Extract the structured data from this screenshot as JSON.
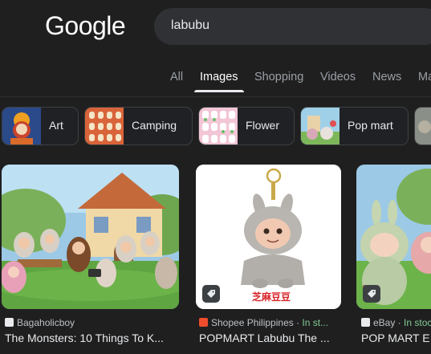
{
  "logo": "Google",
  "search": {
    "value": "labubu"
  },
  "tabs": [
    {
      "label": "All"
    },
    {
      "label": "Images"
    },
    {
      "label": "Shopping"
    },
    {
      "label": "Videos"
    },
    {
      "label": "News"
    },
    {
      "label": "Ma"
    }
  ],
  "chips": [
    {
      "label": "Art"
    },
    {
      "label": "Camping"
    },
    {
      "label": "Flower"
    },
    {
      "label": "Pop mart"
    }
  ],
  "results": [
    {
      "source": "Bagaholicboy",
      "stock": "",
      "title": "The Monsters: 10 Things To K..."
    },
    {
      "source": "Shopee Philippines · ",
      "stock": "In st...",
      "title": "POPMART Labubu The ..."
    },
    {
      "source": "eBay · ",
      "stock": "In stoc",
      "title": "POP MART E"
    }
  ],
  "product_caption": "芝麻豆豆",
  "colors": {
    "background": "#1f1f1f",
    "search_bg": "#303134",
    "in_stock": "#81c995"
  }
}
